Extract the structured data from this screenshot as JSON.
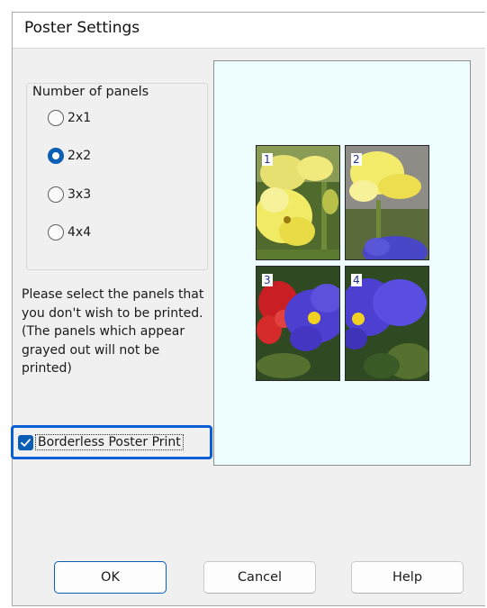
{
  "dialog": {
    "title": "Poster Settings"
  },
  "panels_group": {
    "legend": "Number of panels",
    "options": [
      {
        "label": "2x1",
        "selected": false
      },
      {
        "label": "2x2",
        "selected": true
      },
      {
        "label": "3x3",
        "selected": false
      },
      {
        "label": "4x4",
        "selected": false
      }
    ]
  },
  "instruction": "Please select the panels that you don't wish to be printed. (The panels which appear grayed out will not be printed)",
  "preview": {
    "panels": [
      {
        "number": "1"
      },
      {
        "number": "2"
      },
      {
        "number": "3"
      },
      {
        "number": "4"
      }
    ]
  },
  "borderless": {
    "label": "Borderless Poster Print",
    "checked": true
  },
  "buttons": {
    "ok": "OK",
    "cancel": "Cancel",
    "help": "Help"
  },
  "colors": {
    "accent": "#0a5fb4",
    "focus": "#0a5fd6",
    "preview_bg": "#eefefe"
  },
  "icons": {
    "checkbox": "checkmark-icon",
    "radio": "radio-dot-icon"
  }
}
